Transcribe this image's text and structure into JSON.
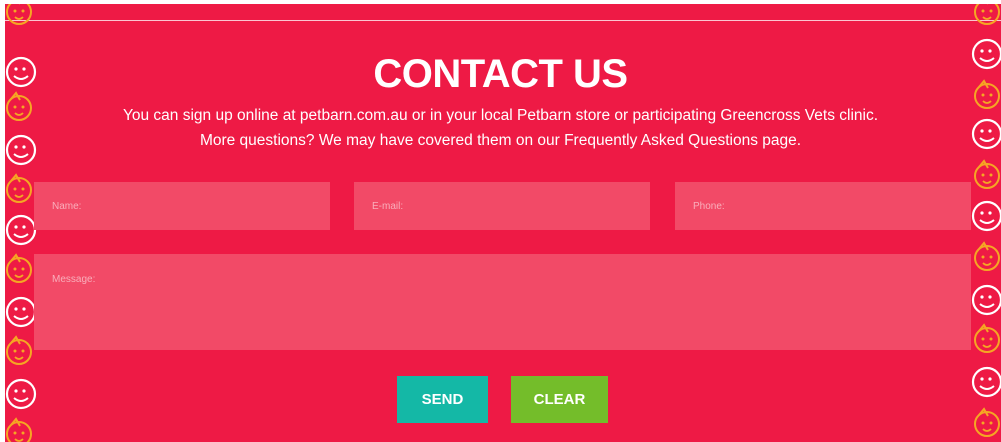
{
  "page": {
    "title": "CONTACT US",
    "subtitle_line1": "You can sign up online at petbarn.com.au or in your local Petbarn store or participating Greencross Vets clinic.",
    "subtitle_line2": "More questions? We may have covered them on our Frequently Asked Questions page."
  },
  "form": {
    "name_placeholder": "Name:",
    "email_placeholder": "E-mail:",
    "phone_placeholder": "Phone:",
    "message_placeholder": "Message:",
    "send_label": "SEND",
    "clear_label": "CLEAR"
  },
  "colors": {
    "background": "#ee1a45",
    "field": "#f24a67",
    "send_button": "#14b8a6",
    "clear_button": "#74bd2a",
    "pattern_white": "#ffffff",
    "pattern_orange": "#f5a623"
  },
  "icons": {
    "pattern": [
      "smiley-face-icon",
      "dog-face-icon"
    ]
  }
}
